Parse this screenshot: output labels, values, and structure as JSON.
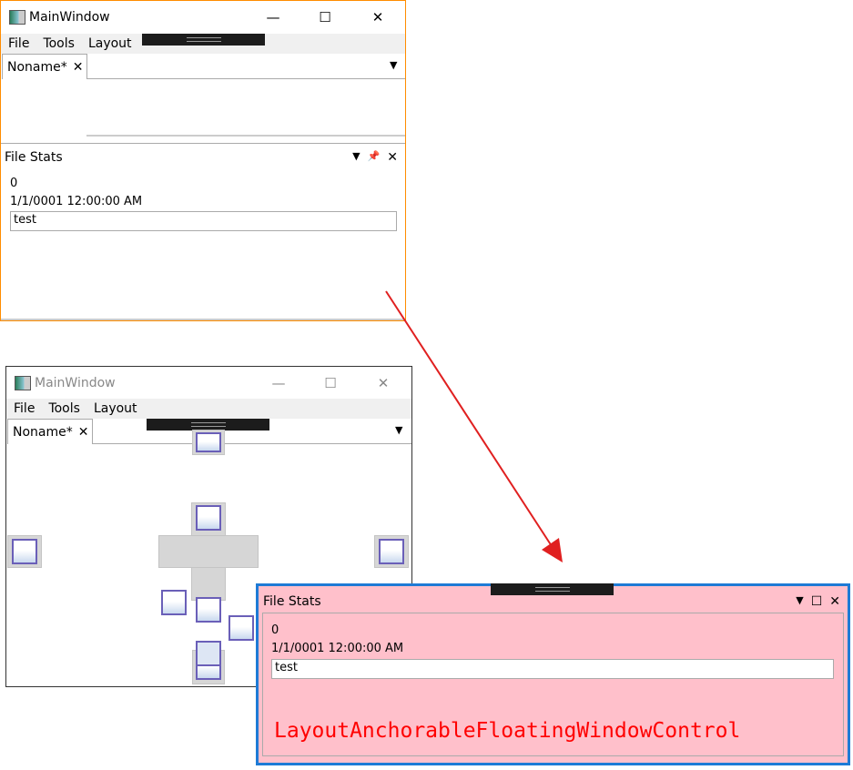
{
  "main_window": {
    "title": "MainWindow",
    "minimize": "—",
    "maximize": "☐",
    "close": "✕",
    "menu": [
      "File",
      "Tools",
      "Layout"
    ],
    "document_tab": {
      "label": "Noname*",
      "close": "✕"
    },
    "overflow_icon": "▼",
    "file_stats": {
      "title": "File Stats",
      "dropdown": "▼",
      "pin": "📌",
      "close": "✕",
      "count": "0",
      "date": "1/1/0001 12:00:00 AM",
      "textbox_value": "test"
    }
  },
  "dock_window": {
    "title": "MainWindow",
    "minimize": "—",
    "maximize": "☐",
    "close": "✕",
    "menu": [
      "File",
      "Tools",
      "Layout"
    ],
    "document_tab": {
      "label": "Noname*",
      "close": "✕"
    }
  },
  "floating_window": {
    "title": "File Stats",
    "dropdown": "▼",
    "maximize": "☐",
    "close": "✕",
    "count": "0",
    "date": "1/1/0001 12:00:00 AM",
    "textbox_value": "test",
    "annotation": "LayoutAnchorableFloatingWindowControl"
  },
  "colors": {
    "active_border": "#ff8c00",
    "float_border": "#1e7bd6",
    "float_bg": "#ffc0cb",
    "annotation": "#ff0000",
    "arrow": "#e02020"
  }
}
